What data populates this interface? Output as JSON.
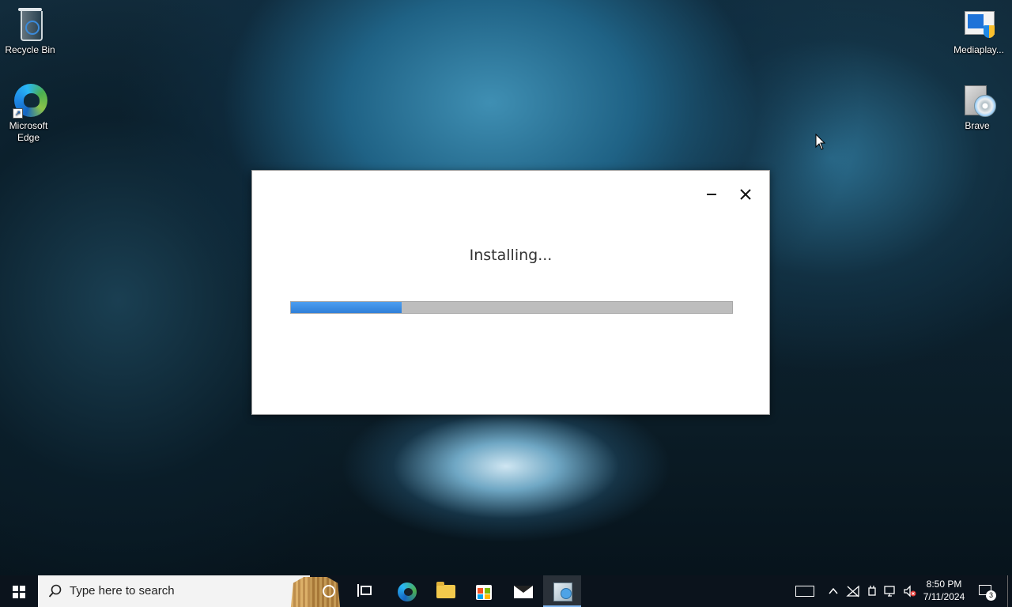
{
  "desktop": {
    "icons": [
      {
        "label": "Recycle Bin"
      },
      {
        "label": "Microsoft Edge"
      },
      {
        "label": "Mediaplay..."
      },
      {
        "label": "Brave"
      }
    ]
  },
  "installer": {
    "status_text": "Installing...",
    "progress_percent": 25,
    "accent_color": "#3a8ee6"
  },
  "taskbar": {
    "search_placeholder": "Type here to search",
    "pinned": [
      "cortana-icon",
      "task-view-icon",
      "edge-icon",
      "file-explorer-icon",
      "microsoft-store-icon",
      "mail-icon",
      "installer-app-icon"
    ],
    "clock_time": "8:50 PM",
    "clock_date": "7/11/2024",
    "notification_count": "3"
  }
}
